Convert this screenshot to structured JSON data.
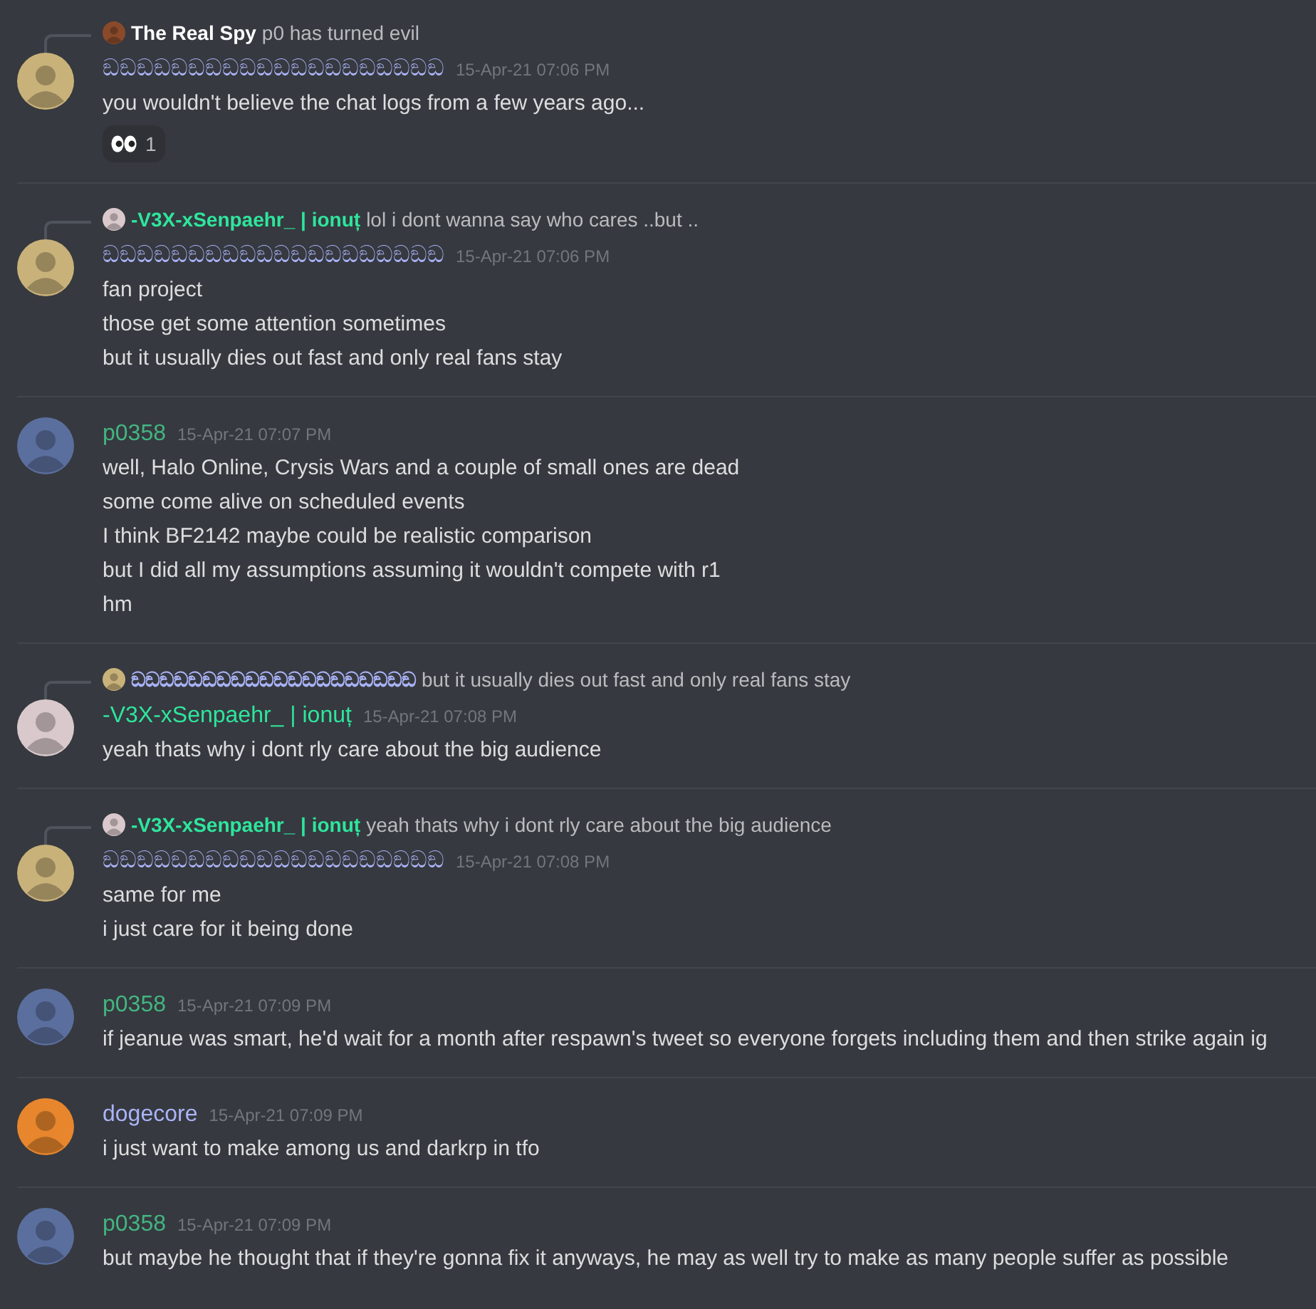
{
  "messages": [
    {
      "reply": {
        "author": "The Real Spy",
        "color": "#ffffff",
        "avatar": {
          "color": "#8a4a2a"
        },
        "text": "p0 has turned evil"
      },
      "author": "ඞඞඞඞඞඞඞඞඞඞඞඞඞඞඞඞඞඞඞඞ",
      "color": "#a9b3f7",
      "avatar": {
        "color": "#c9b27a"
      },
      "timestamp": "15-Apr-21 07:06 PM",
      "lines": [
        "you wouldn't believe the chat logs from a few years ago..."
      ],
      "reactions": [
        {
          "count": "1"
        }
      ]
    },
    {
      "reply": {
        "author": "-V3X-xSenpaehr_ | ionuț",
        "color": "#2ee59d",
        "avatar": {
          "color": "#d9c9cc"
        },
        "text": "lol i dont wanna say who cares ..but .."
      },
      "author": "ඞඞඞඞඞඞඞඞඞඞඞඞඞඞඞඞඞඞඞඞ",
      "color": "#a9b3f7",
      "avatar": {
        "color": "#c9b27a"
      },
      "timestamp": "15-Apr-21 07:06 PM",
      "lines": [
        "fan project",
        "those get some attention sometimes",
        "but it usually dies out fast and only real fans stay"
      ]
    },
    {
      "author": "p0358",
      "color": "#43b581",
      "avatar": {
        "color": "#5b6f9e"
      },
      "timestamp": "15-Apr-21 07:07 PM",
      "lines": [
        "well, Halo Online, Crysis Wars and a couple of small ones are dead",
        "some come alive on scheduled events",
        "I think BF2142 maybe could be realistic comparison",
        "but I did all my assumptions assuming it wouldn't compete with r1",
        "hm"
      ]
    },
    {
      "reply": {
        "author": "ඞඞඞඞඞඞඞඞඞඞඞඞඞඞඞඞඞඞඞඞ",
        "color": "#a9b3f7",
        "avatar": {
          "color": "#c9b27a"
        },
        "text": "but it usually dies out fast and only real fans stay"
      },
      "author": "-V3X-xSenpaehr_ | ionuț",
      "color": "#2ee59d",
      "avatar": {
        "color": "#d9c9cc"
      },
      "timestamp": "15-Apr-21 07:08 PM",
      "lines": [
        "yeah thats why i dont rly care about the big audience"
      ]
    },
    {
      "reply": {
        "author": "-V3X-xSenpaehr_ | ionuț",
        "color": "#2ee59d",
        "avatar": {
          "color": "#d9c9cc"
        },
        "text": "yeah thats why i dont rly care about the big audience"
      },
      "author": "ඞඞඞඞඞඞඞඞඞඞඞඞඞඞඞඞඞඞඞඞ",
      "color": "#a9b3f7",
      "avatar": {
        "color": "#c9b27a"
      },
      "timestamp": "15-Apr-21 07:08 PM",
      "lines": [
        "same for me",
        "i just care for it being done"
      ]
    },
    {
      "author": "p0358",
      "color": "#43b581",
      "avatar": {
        "color": "#5b6f9e"
      },
      "timestamp": "15-Apr-21 07:09 PM",
      "lines": [
        "if jeanue was smart, he'd wait for a month after respawn's tweet so everyone forgets including them and then strike again ig"
      ]
    },
    {
      "author": "dogecore",
      "color": "#a9b3f7",
      "avatar": {
        "color": "#e8862d"
      },
      "timestamp": "15-Apr-21 07:09 PM",
      "lines": [
        "i just want to make among us and darkrp in tfo"
      ]
    },
    {
      "author": "p0358",
      "color": "#43b581",
      "avatar": {
        "color": "#5b6f9e"
      },
      "timestamp": "15-Apr-21 07:09 PM",
      "lines": [
        "but maybe he thought that if they're gonna fix it anyways, he may as well try to make as many people suffer as possible"
      ]
    }
  ]
}
